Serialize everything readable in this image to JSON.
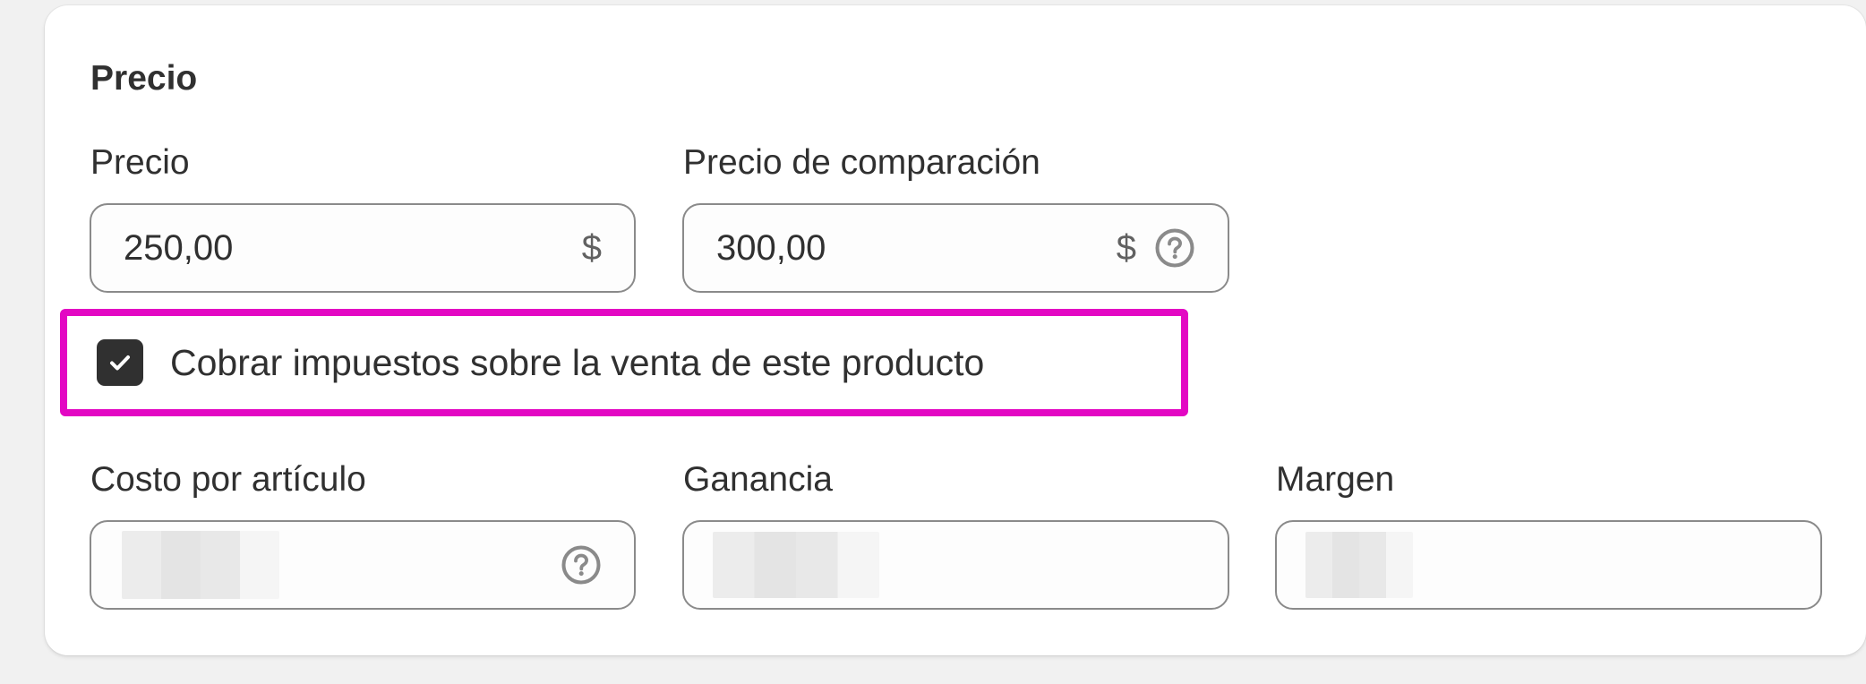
{
  "section": {
    "title": "Precio"
  },
  "price": {
    "label": "Precio",
    "value": "250,00",
    "currency": "$"
  },
  "compare_price": {
    "label": "Precio de comparación",
    "value": "300,00",
    "currency": "$",
    "help_icon": "question-circle-icon"
  },
  "tax": {
    "checked": true,
    "label": "Cobrar impuestos sobre la venta de este producto",
    "highlight_color": "#e308c3"
  },
  "cost": {
    "label": "Costo por artículo",
    "value_redacted": true,
    "help_icon": "question-circle-icon"
  },
  "profit": {
    "label": "Ganancia",
    "value_redacted": true
  },
  "margin": {
    "label": "Margen",
    "value_redacted": true
  },
  "colors": {
    "background": "#f1f1f1",
    "card": "#ffffff",
    "text": "#303030",
    "border": "#8a8a8a",
    "checkbox_fill": "#303030"
  }
}
